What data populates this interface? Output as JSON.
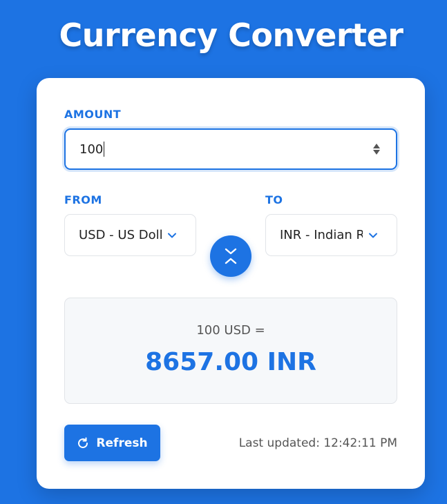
{
  "app": {
    "title": "Currency Converter"
  },
  "amount": {
    "label": "AMOUNT",
    "value": "100"
  },
  "from": {
    "label": "FROM",
    "selected": "USD - US Dollar"
  },
  "to": {
    "label": "TO",
    "selected": "INR - Indian Rupee"
  },
  "swap": {
    "icon": "swap-vertical-icon"
  },
  "result": {
    "from_text": "100 USD =",
    "to_text": "8657.00 INR"
  },
  "refresh": {
    "label": "Refresh",
    "icon": "refresh-icon"
  },
  "status": {
    "last_updated": "Last updated: 12:42:11 PM"
  },
  "colors": {
    "accent": "#1d73e3",
    "background": "#1d73e3",
    "card": "#ffffff",
    "result_bg": "#f6f8fa"
  }
}
